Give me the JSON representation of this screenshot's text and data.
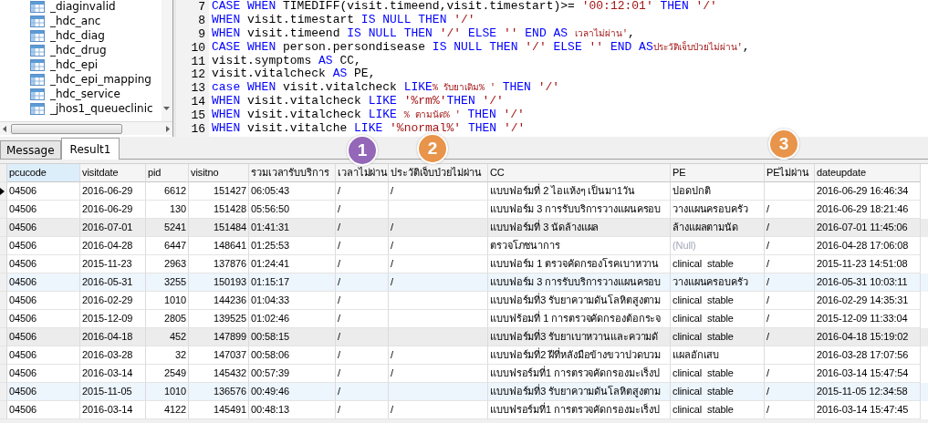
{
  "tree": {
    "items": [
      "_diaginvalid",
      "_hdc_anc",
      "_hdc_diag",
      "_hdc_drug",
      "_hdc_epi",
      "_hdc_epi_mapping",
      "_hdc_service",
      "_jhos1_queueclinic"
    ]
  },
  "editor": {
    "lines": [
      {
        "number": "7",
        "tokens": [
          {
            "kind": "keyword",
            "text": "CASE WHEN"
          },
          {
            "kind": "plain",
            "text": " TIMEDIFF(visit.timeend,visit.timestart)>= "
          },
          {
            "kind": "string",
            "text": "'00:12:01'"
          },
          {
            "kind": "keyword",
            "text": " THEN "
          },
          {
            "kind": "string",
            "text": "'/'"
          }
        ]
      },
      {
        "number": "8",
        "tokens": [
          {
            "kind": "keyword",
            "text": "WHEN"
          },
          {
            "kind": "plain",
            "text": " visit.timestart "
          },
          {
            "kind": "keyword",
            "text": "IS NULL THEN "
          },
          {
            "kind": "string",
            "text": "'/'"
          }
        ]
      },
      {
        "number": "9",
        "tokens": [
          {
            "kind": "keyword",
            "text": "WHEN"
          },
          {
            "kind": "plain",
            "text": " visit.timeend "
          },
          {
            "kind": "keyword",
            "text": "IS NULL THEN "
          },
          {
            "kind": "string",
            "text": "'/'"
          },
          {
            "kind": "keyword",
            "text": " ELSE "
          },
          {
            "kind": "string",
            "text": "''"
          },
          {
            "kind": "keyword",
            "text": " END AS "
          },
          {
            "kind": "string",
            "text": "เวลาไม่ผ่าน'"
          },
          {
            "kind": "plain",
            "text": ","
          }
        ]
      },
      {
        "number": "10",
        "tokens": [
          {
            "kind": "keyword",
            "text": "CASE WHEN"
          },
          {
            "kind": "plain",
            "text": " person.persondisease "
          },
          {
            "kind": "keyword",
            "text": "IS NULL THEN "
          },
          {
            "kind": "string",
            "text": "'/'"
          },
          {
            "kind": "keyword",
            "text": " ELSE "
          },
          {
            "kind": "string",
            "text": "''"
          },
          {
            "kind": "keyword",
            "text": " END AS"
          },
          {
            "kind": "string",
            "text": "ประวัติเจ็บป่วยไม่ผ่าน'"
          },
          {
            "kind": "plain",
            "text": ","
          }
        ]
      },
      {
        "number": "11",
        "tokens": [
          {
            "kind": "plain",
            "text": "visit.symptoms "
          },
          {
            "kind": "keyword",
            "text": "AS"
          },
          {
            "kind": "plain",
            "text": " CC,"
          }
        ]
      },
      {
        "number": "12",
        "tokens": [
          {
            "kind": "plain",
            "text": "visit.vitalcheck "
          },
          {
            "kind": "keyword",
            "text": "AS"
          },
          {
            "kind": "plain",
            "text": " PE,"
          }
        ]
      },
      {
        "number": "13",
        "tokens": [
          {
            "kind": "keyword",
            "text": "case WHEN"
          },
          {
            "kind": "plain",
            "text": " visit.vitalcheck "
          },
          {
            "kind": "keyword",
            "text": "LIKE"
          },
          {
            "kind": "string",
            "text": "% รับยาเดิม% '"
          },
          {
            "kind": "keyword",
            "text": " THEN "
          },
          {
            "kind": "string",
            "text": "'/'"
          }
        ]
      },
      {
        "number": "14",
        "tokens": [
          {
            "kind": "keyword",
            "text": "WHEN"
          },
          {
            "kind": "plain",
            "text": " visit.vitalcheck "
          },
          {
            "kind": "keyword",
            "text": "LIKE "
          },
          {
            "kind": "string",
            "text": "'%rm%'"
          },
          {
            "kind": "keyword",
            "text": "THEN "
          },
          {
            "kind": "string",
            "text": "'/'"
          }
        ]
      },
      {
        "number": "15",
        "tokens": [
          {
            "kind": "keyword",
            "text": "WHEN"
          },
          {
            "kind": "plain",
            "text": " visit.vitalcheck "
          },
          {
            "kind": "keyword",
            "text": "LIKE "
          },
          {
            "kind": "string",
            "text": "% ตามนัด% '"
          },
          {
            "kind": "keyword",
            "text": " THEN "
          },
          {
            "kind": "string",
            "text": "'/'"
          }
        ]
      },
      {
        "number": "16",
        "tokens": [
          {
            "kind": "keyword",
            "text": "WHEN"
          },
          {
            "kind": "plain",
            "text": " visit.vitalche"
          },
          {
            "kind": "keyword",
            "text": " LIKE "
          },
          {
            "kind": "string",
            "text": "'%normal%'"
          },
          {
            "kind": "keyword",
            "text": " THEN "
          },
          {
            "kind": "string",
            "text": "'/'"
          }
        ]
      }
    ]
  },
  "tabs": [
    {
      "label": "Message",
      "selected": false
    },
    {
      "label": "Result1",
      "selected": true
    }
  ],
  "badges": [
    {
      "number": "1",
      "color": "#9467b8"
    },
    {
      "number": "2",
      "color": "#e8944a"
    },
    {
      "number": "3",
      "color": "#e8944a"
    }
  ],
  "table": {
    "columns": [
      {
        "label": "pcucode",
        "selected": true
      },
      {
        "label": "visitdate",
        "selected": false
      },
      {
        "label": "pid",
        "selected": false
      },
      {
        "label": "visitno",
        "selected": false
      },
      {
        "label": "รวมเวลารับบริการ",
        "selected": false
      },
      {
        "label": "เวลาไม่ผ่าน",
        "selected": false
      },
      {
        "label": "ประวัติเจ็บป่วยไม่ผ่าน",
        "selected": false
      },
      {
        "label": "CC",
        "selected": false
      },
      {
        "label": "PE",
        "selected": false
      },
      {
        "label": "PEไม่ผ่าน",
        "selected": false
      },
      {
        "label": "dateupdate",
        "selected": false
      }
    ],
    "rows": [
      {
        "selected": true,
        "shaded": false,
        "highlighted": false,
        "pcucode": "04506",
        "visitdate": "2016-06-29",
        "pid": "6612",
        "visitno": "151427",
        "total_time": "06:05:43",
        "time_fail": "/",
        "history_fail": "/",
        "cc": "แบบฟอร์มที่ 2 ไอแห้งๆ เป็นมา1วัน",
        "pe": "ปอดปกติ",
        "dateupdate": "2016-06-29 16:46:34"
      },
      {
        "selected": false,
        "shaded": false,
        "highlighted": false,
        "pcucode": "04506",
        "visitdate": "2016-06-29",
        "pid": "130",
        "visitno": "151428",
        "total_time": "05:56:50",
        "time_fail": "/",
        "cc": "แบบฟอร์ม 3 การรับบริการวางแผนครอบ",
        "pe": "วางแผนครอบครัว",
        "pe_fail": "/",
        "dateupdate": "2016-06-29 18:21:46"
      },
      {
        "selected": false,
        "shaded": true,
        "highlighted": false,
        "pcucode": "04506",
        "visitdate": "2016-07-01",
        "pid": "5241",
        "visitno": "151484",
        "total_time": "01:41:31",
        "time_fail": "/",
        "history_fail": "/",
        "cc": "แบบฟอร์มที่ 3 นัดล้างแผล",
        "pe": "ล้างแผลตามนัด",
        "pe_fail": "/",
        "dateupdate": "2016-07-01 11:45:06"
      },
      {
        "selected": false,
        "shaded": false,
        "highlighted": false,
        "null_pe": true,
        "pcucode": "04506",
        "visitdate": "2016-04-28",
        "pid": "6447",
        "visitno": "148641",
        "total_time": "01:25:53",
        "time_fail": "/",
        "history_fail": "/",
        "cc": "ตรวจโภชนาการ",
        "pe": "(Null)",
        "pe_fail": "/",
        "dateupdate": "2016-04-28 17:06:08"
      },
      {
        "selected": false,
        "shaded": false,
        "highlighted": false,
        "pcucode": "04506",
        "visitdate": "2015-11-23",
        "pid": "2963",
        "visitno": "137876",
        "total_time": "01:24:41",
        "time_fail": "/",
        "history_fail": "/",
        "cc": "แบบฟอร์ม 1 ตรวจคัดกรองโรคเบาหวาน",
        "pe": "clinical  stable",
        "pe_fail": "/",
        "dateupdate": "2015-11-23 14:51:08"
      },
      {
        "selected": false,
        "shaded": false,
        "highlighted": true,
        "pcucode": "04506",
        "visitdate": "2016-05-31",
        "pid": "3255",
        "visitno": "150193",
        "total_time": "01:15:17",
        "time_fail": "/",
        "history_fail": "/",
        "cc": "แบบฟอร์ม 3 การรับบริการวางแผนครอบ",
        "pe": "วางแผนครอบครัว",
        "pe_fail": "/",
        "dateupdate": "2016-05-31 10:03:11"
      },
      {
        "selected": false,
        "shaded": false,
        "highlighted": false,
        "pcucode": "04506",
        "visitdate": "2016-02-29",
        "pid": "1010",
        "visitno": "144236",
        "total_time": "01:04:33",
        "time_fail": "/",
        "cc": "แบบฟอร์มที่3 รับยาความดันโลหิตสูงตาม",
        "pe": "clinical  stable",
        "pe_fail": "/",
        "dateupdate": "2016-02-29 14:35:31"
      },
      {
        "selected": false,
        "shaded": false,
        "highlighted": false,
        "pcucode": "04506",
        "visitdate": "2015-12-09",
        "pid": "2805",
        "visitno": "139525",
        "total_time": "01:02:46",
        "time_fail": "/",
        "cc": "แบบฟร้อมที่ 1 การตรวจคัดกรองต้อกระจ",
        "pe": "clinical  stable",
        "pe_fail": "/",
        "dateupdate": "2015-12-09 11:33:04"
      },
      {
        "selected": false,
        "shaded": true,
        "highlighted": false,
        "pcucode": "04506",
        "visitdate": "2016-04-18",
        "pid": "452",
        "visitno": "147899",
        "total_time": "00:58:15",
        "time_fail": "/",
        "cc": "แบบฟอร์มที่3 รับยาเบาหวานและความดั",
        "pe": "clinical  stable",
        "pe_fail": "/",
        "dateupdate": "2016-04-18 15:19:02"
      },
      {
        "selected": false,
        "shaded": false,
        "highlighted": false,
        "pcucode": "04506",
        "visitdate": "2016-03-28",
        "pid": "32",
        "visitno": "147037",
        "total_time": "00:58:06",
        "time_fail": "/",
        "history_fail": "/",
        "cc": "แบบฟอร์มที่2 ฝีที่หลังมือข้างขวาปวดบวม",
        "pe": "แผลอักเสบ",
        "dateupdate": "2016-03-28 17:07:56"
      },
      {
        "selected": false,
        "shaded": false,
        "highlighted": false,
        "pcucode": "04506",
        "visitdate": "2016-03-14",
        "pid": "2549",
        "visitno": "145432",
        "total_time": "00:57:39",
        "time_fail": "/",
        "history_fail": "/",
        "cc": "แบบฟรอร์มที่1 การตรวจคัดกรองมะเร็งป",
        "pe": "clinical  stable",
        "pe_fail": "/",
        "dateupdate": "2016-03-14 15:47:54"
      },
      {
        "selected": false,
        "shaded": false,
        "highlighted": true,
        "pcucode": "04506",
        "visitdate": "2015-11-05",
        "pid": "1010",
        "visitno": "136576",
        "total_time": "00:49:46",
        "time_fail": "/",
        "cc": "แบบฟอร์มที่3 รับยาความดันโลหิตสูงตาม",
        "pe": "clinical  stable",
        "pe_fail": "/",
        "dateupdate": "2015-11-05 12:34:58"
      },
      {
        "selected": false,
        "shaded": false,
        "highlighted": false,
        "pcucode": "04506",
        "visitdate": "2016-03-14",
        "pid": "4122",
        "visitno": "145491",
        "total_time": "00:48:13",
        "time_fail": "/",
        "history_fail": "/",
        "cc": "แบบฟรอร์มที่1 การตรวจคัดกรองมะเร็งป",
        "pe": "clinical  stable",
        "pe_fail": "/",
        "dateupdate": "2016-03-14 15:47:45"
      }
    ]
  }
}
